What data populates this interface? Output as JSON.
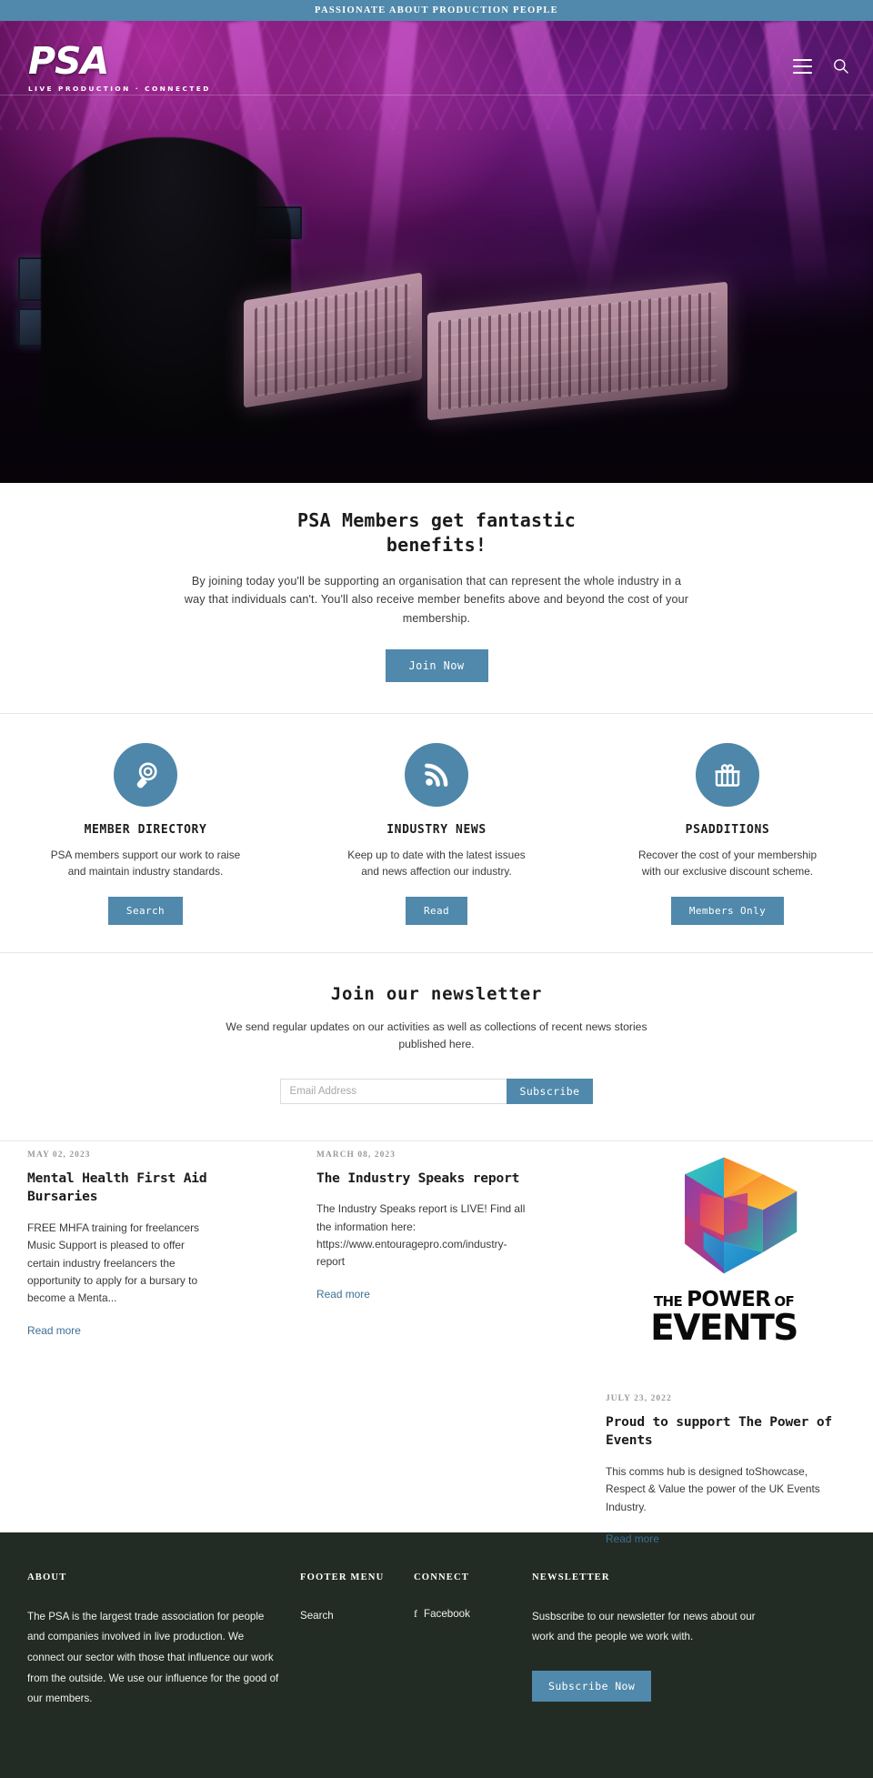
{
  "announcement": {
    "text": "PASSIONATE ABOUT PRODUCTION PEOPLE"
  },
  "header": {
    "logo_text": "PSA",
    "logo_tagline": "LIVE PRODUCTION · CONNECTED",
    "menu_icon": "hamburger-menu-icon",
    "search_icon": "search-icon"
  },
  "intro": {
    "title": "PSA Members get fantastic benefits!",
    "copy": "By joining today you'll be supporting an organisation that can represent the whole industry in a way that individuals can't. You'll also receive member benefits above and beyond the cost of your membership.",
    "cta_label": "Join Now"
  },
  "features": [
    {
      "icon": "magnifier-icon",
      "title": "MEMBER DIRECTORY",
      "copy": "PSA members support our work to raise and maintain industry standards.",
      "button": "Search"
    },
    {
      "icon": "rss-feed-icon",
      "title": "INDUSTRY NEWS",
      "copy": "Keep up to date with the latest issues and news affection our industry.",
      "button": "Read"
    },
    {
      "icon": "gift-box-icon",
      "title": "PSADDITIONS",
      "copy": "Recover the cost of your membership with our exclusive discount scheme.",
      "button": "Members Only"
    }
  ],
  "newsletter": {
    "title": "Join our newsletter",
    "copy": "We send regular updates on our activities as well as collections of recent news stories published here.",
    "email_placeholder": "Email Address",
    "email_value": "",
    "subscribe_label": "Subscribe"
  },
  "articles": [
    {
      "date": "MAY 02, 2023",
      "title": "Mental Health First Aid Bursaries",
      "excerpt": "FREE MHFA training for freelancers Music Support is pleased to offer certain industry freelancers the opportunity to apply for a bursary to become a Menta...",
      "read_more": "Read more"
    },
    {
      "date": "MARCH 08, 2023",
      "title": "The Industry Speaks report",
      "excerpt": "The Industry Speaks report is LIVE! Find all the information here: https://www.entouragepro.com/industry-report",
      "read_more": "Read more"
    },
    {
      "date": "JULY 23, 2022",
      "title": "Proud to support The Power of Events",
      "excerpt": "This comms hub is designed toShowcase, Respect & Value the power of the UK Events Industry.",
      "read_more": "Read more",
      "image": {
        "name": "power-of-events-logo",
        "word_the": "THE",
        "word_power": "POWER",
        "word_of": "OF",
        "word_events": "EVENTS"
      }
    }
  ],
  "footer": {
    "about": {
      "heading": "ABOUT",
      "body": "The PSA is the largest trade association for people and companies involved in live production. We connect our sector with those that influence our work from the outside. We use our influence for the good of our members."
    },
    "menu": {
      "heading": "FOOTER MENU",
      "items": [
        "Search"
      ]
    },
    "connect": {
      "heading": "CONNECT",
      "facebook_glyph": "f",
      "items": [
        "Facebook"
      ]
    },
    "newsletter": {
      "heading": "NEWSLETTER",
      "body": "Susbscribe to our newsletter for news about our work and the people we work with.",
      "button": "Subscribe Now"
    }
  },
  "colors": {
    "accent": "#5089ab",
    "icon_circle": "#4e87a9",
    "footer_bg": "#222c25",
    "link": "#3c6f95"
  }
}
